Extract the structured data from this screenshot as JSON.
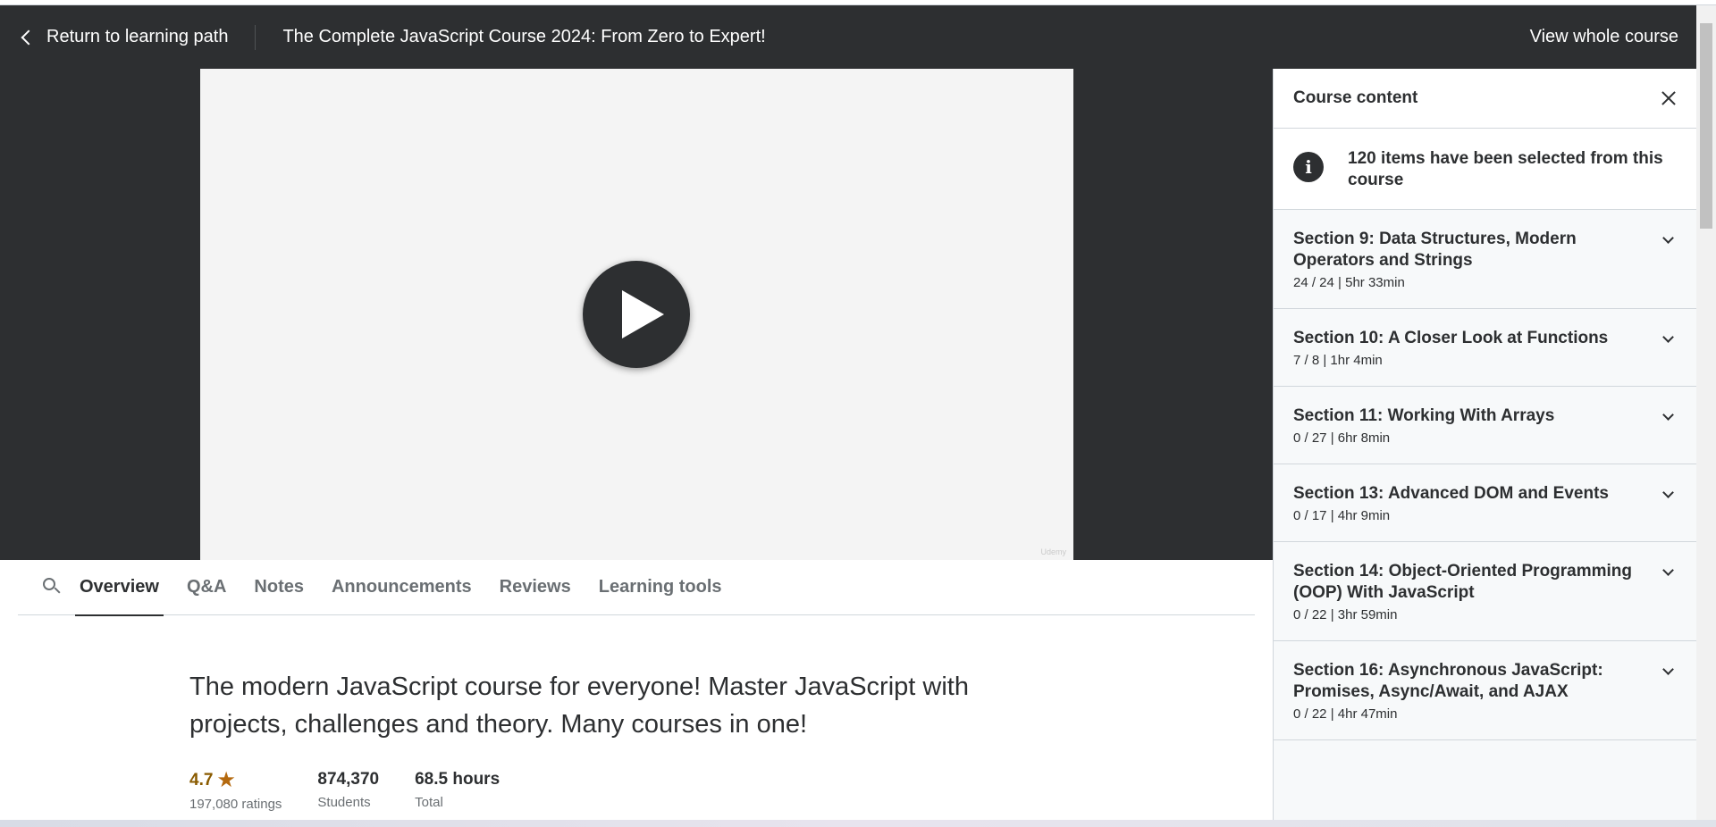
{
  "header": {
    "back_label": "Return to learning path",
    "course_title": "The Complete JavaScript Course 2024: From Zero to Expert!",
    "view_whole_label": "View whole course"
  },
  "video": {
    "watermark": "Udemy"
  },
  "tabs": [
    {
      "label": "Overview",
      "active": true
    },
    {
      "label": "Q&A",
      "active": false
    },
    {
      "label": "Notes",
      "active": false
    },
    {
      "label": "Announcements",
      "active": false
    },
    {
      "label": "Reviews",
      "active": false
    },
    {
      "label": "Learning tools",
      "active": false
    }
  ],
  "overview": {
    "headline": "The modern JavaScript course for everyone! Master JavaScript with projects, challenges and theory. Many courses in one!",
    "stats": {
      "rating": {
        "value": "4.7",
        "label": "197,080 ratings"
      },
      "students": {
        "value": "874,370",
        "label": "Students"
      },
      "total": {
        "value": "68.5 hours",
        "label": "Total"
      }
    }
  },
  "sidebar": {
    "title": "Course content",
    "info_text": "120 items have been selected from this course",
    "sections": [
      {
        "title": "Section 9: Data Structures, Modern Operators and Strings",
        "meta": "24 / 24 | 5hr 33min"
      },
      {
        "title": "Section 10: A Closer Look at Functions",
        "meta": "7 / 8 | 1hr 4min"
      },
      {
        "title": "Section 11: Working With Arrays",
        "meta": "0 / 27 | 6hr 8min"
      },
      {
        "title": "Section 13: Advanced DOM and Events",
        "meta": "0 / 17 | 4hr 9min"
      },
      {
        "title": "Section 14: Object-Oriented Programming (OOP) With JavaScript",
        "meta": "0 / 22 | 3hr 59min"
      },
      {
        "title": "Section 16: Asynchronous JavaScript: Promises, Async/Await, and AJAX",
        "meta": "0 / 22 | 4hr 47min"
      }
    ]
  },
  "colors": {
    "header_bg": "#2d2f31",
    "rating_star": "#b4690e"
  }
}
